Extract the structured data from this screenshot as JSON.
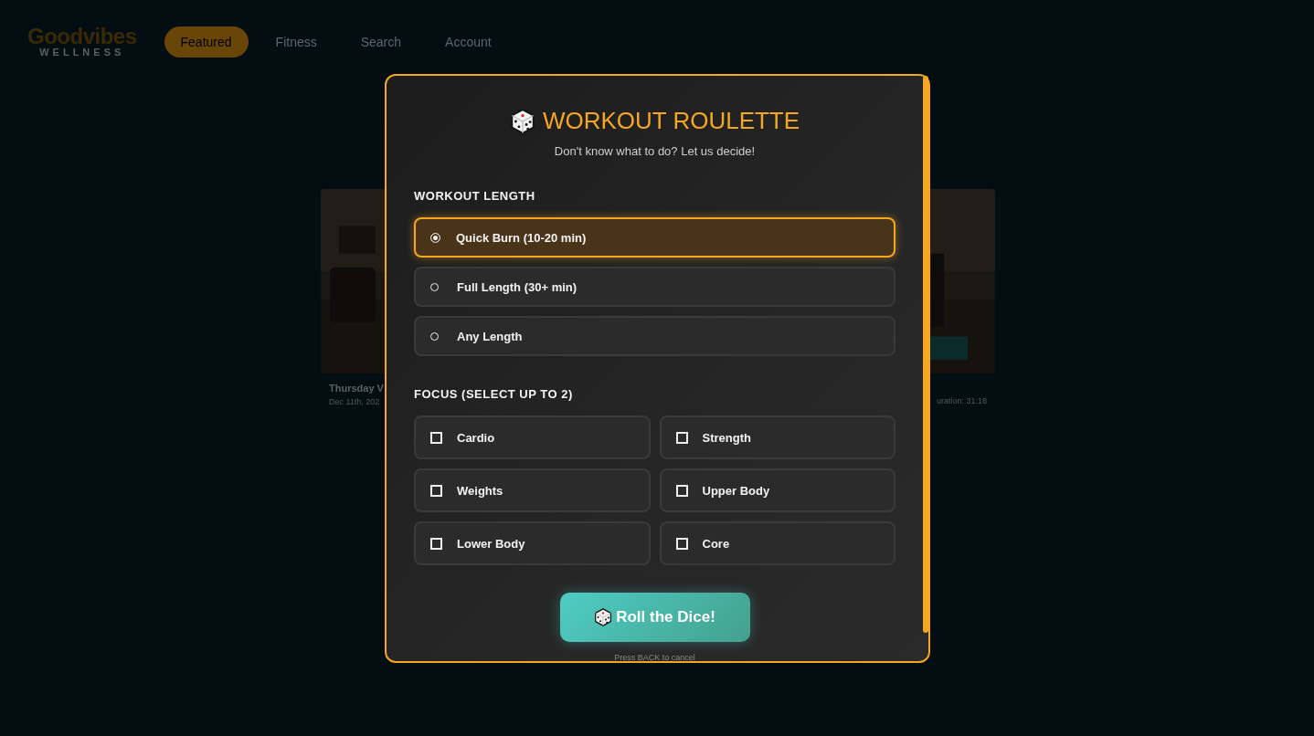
{
  "logo": {
    "top": "Goodvibes",
    "bottom": "WELLNESS"
  },
  "nav": [
    {
      "label": "Featured",
      "selected": true
    },
    {
      "label": "Fitness",
      "selected": false
    },
    {
      "label": "Search",
      "selected": false
    },
    {
      "label": "Account",
      "selected": false
    }
  ],
  "cards": [
    {
      "kind": "picture",
      "title": "Thursday V",
      "meta": "Dec 11th, 202"
    },
    {
      "kind": "picture",
      "meta": "uration: 31:18"
    }
  ],
  "modal": {
    "title": "WORKOUT ROULETTE",
    "subtitle": "Don't know what to do? Let us decide!",
    "length_heading": "WORKOUT LENGTH",
    "lengths": [
      {
        "label": "Quick Burn (10-20 min)",
        "selected": true
      },
      {
        "label": "Full Length (30+ min)",
        "selected": false
      },
      {
        "label": "Any Length",
        "selected": false
      }
    ],
    "focus_heading": "FOCUS (SELECT UP TO 2)",
    "focus": [
      {
        "label": "Cardio",
        "checked": false
      },
      {
        "label": "Strength",
        "checked": false
      },
      {
        "label": "Weights",
        "checked": false
      },
      {
        "label": "Upper Body",
        "checked": false
      },
      {
        "label": "Lower Body",
        "checked": false
      },
      {
        "label": "Core",
        "checked": false
      }
    ],
    "button": "Roll the Dice!",
    "hint": "Press BACK to cancel"
  }
}
